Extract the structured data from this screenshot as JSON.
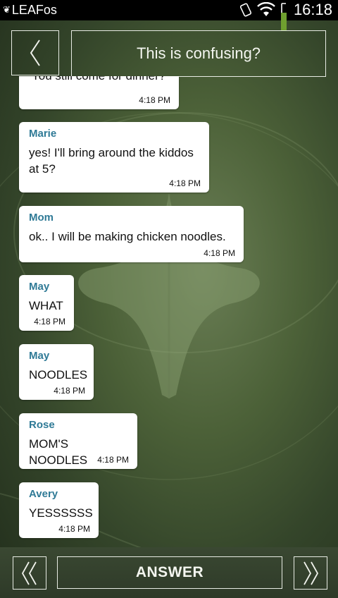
{
  "status_bar": {
    "carrier": "LEAFos",
    "time": "16:18",
    "icons": [
      "leaf-icon",
      "rotate-icon",
      "wifi-icon",
      "battery-icon"
    ]
  },
  "header": {
    "title": "This is confusing?",
    "back_icon": "chevron-left-icon"
  },
  "clipped_message": {
    "text": "You still come for dinner?",
    "time": "4:18 PM"
  },
  "messages": [
    {
      "sender": "Marie",
      "text": "yes! I'll bring around the kiddos at 5?",
      "time": "4:18 PM"
    },
    {
      "sender": "Mom",
      "text": "ok.. I will be making chicken noodles.",
      "time": "4:18 PM"
    },
    {
      "sender": "May",
      "text": "WHAT",
      "time": "4:18 PM"
    },
    {
      "sender": "May",
      "text": "NOODLES",
      "time": "4:18 PM"
    },
    {
      "sender": "Rose",
      "text": "MOM'S NOODLES",
      "time": "4:18 PM"
    },
    {
      "sender": "Avery",
      "text": "YESSSSSS",
      "time": "4:18 PM"
    }
  ],
  "footer": {
    "answer_label": "ANSWER",
    "prev_icon": "double-chevron-left-icon",
    "next_icon": "double-chevron-right-icon"
  },
  "colors": {
    "sender_name": "#2f7a96",
    "battery_level": "#6fa02f",
    "background": "#4c6138"
  }
}
